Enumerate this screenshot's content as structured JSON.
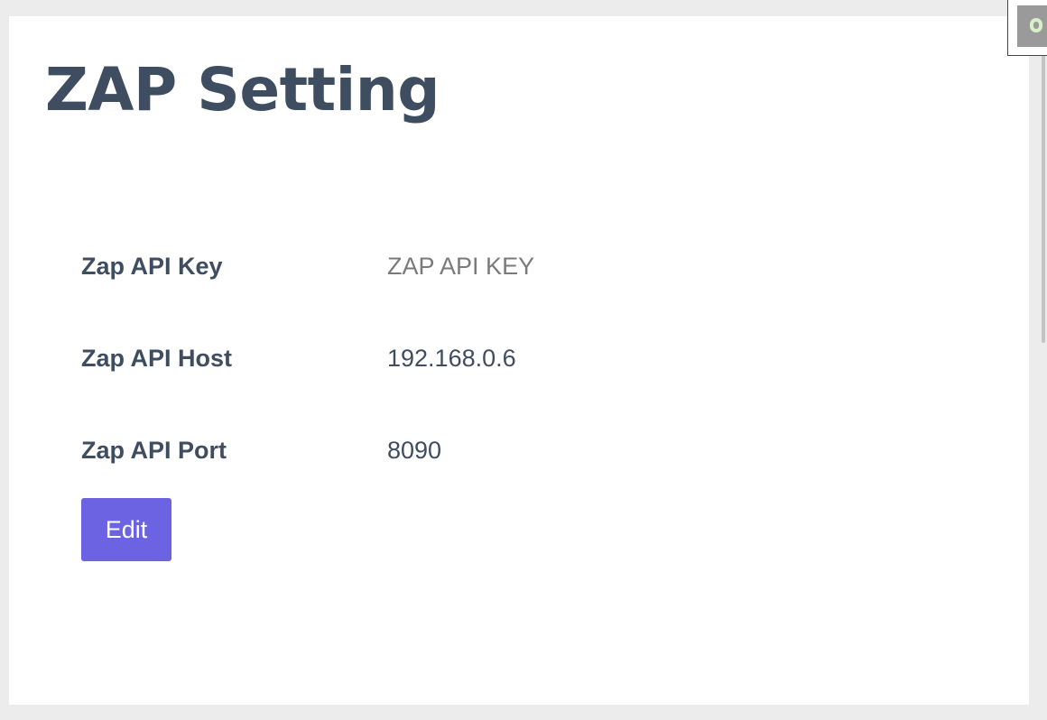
{
  "page": {
    "title": "ZAP Setting"
  },
  "settings": [
    {
      "label": "Zap API Key",
      "value": "ZAP API KEY"
    },
    {
      "label": "Zap API Host",
      "value": "192.168.0.6"
    },
    {
      "label": "Zap API Port",
      "value": "8090"
    }
  ],
  "actions": {
    "edit_label": "Edit"
  },
  "colors": {
    "background": "#ececec",
    "card": "#ffffff",
    "heading": "#3f4d61",
    "placeholder_value": "#7a7a7a",
    "accent": "#6c63e3"
  },
  "icons": {
    "corner_widget": "app-icon"
  }
}
